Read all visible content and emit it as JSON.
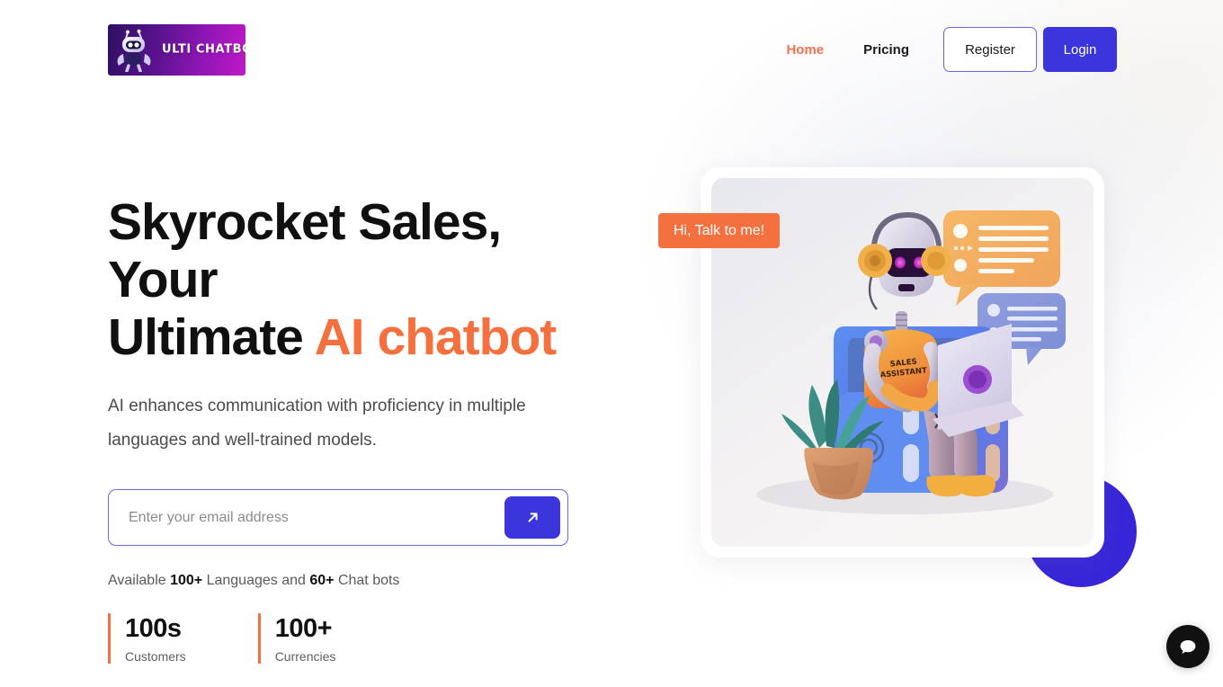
{
  "brand": {
    "logo_text": "ULTI CHATBOT",
    "logo_icon": "robot-mascot-icon"
  },
  "nav": {
    "links": [
      {
        "label": "Home",
        "state": "active"
      },
      {
        "label": "Pricing",
        "state": "default"
      }
    ],
    "register_label": "Register",
    "login_label": "Login"
  },
  "hero": {
    "headline_line1": "Skyrocket Sales, Your",
    "headline_line2_plain": "Ultimate ",
    "headline_line2_accent": "AI chatbot",
    "subhead": "AI enhances communication with proficiency in multiple languages and well-trained models.",
    "talk_badge": "Hi, Talk to me!",
    "robot_chest_text_line1": "SALES",
    "robot_chest_text_line2": "ASSISTANT"
  },
  "email_form": {
    "placeholder": "Enter your email address",
    "value": "",
    "submit_icon": "arrow-up-right-icon"
  },
  "availability": {
    "prefix": "Available ",
    "languages_count": "100+",
    "middle": " Languages and ",
    "bots_count": "60+",
    "suffix": " Chat bots"
  },
  "stats": [
    {
      "value": "100s",
      "label": "Customers"
    },
    {
      "value": "100+",
      "label": "Currencies"
    }
  ],
  "chat_widget": {
    "icon": "chat-bubble-icon"
  },
  "colors": {
    "accent_orange": "#f4703e",
    "brand_indigo": "#3b35db",
    "register_border": "#6c63e8",
    "heading_dark": "#101010",
    "body_gray": "#4b4b4b",
    "logo_gradient_from": "#2d1060",
    "logo_gradient_to": "#c019c8",
    "deco_circle": "#3726d8",
    "chat_widget_bg": "#111111"
  }
}
